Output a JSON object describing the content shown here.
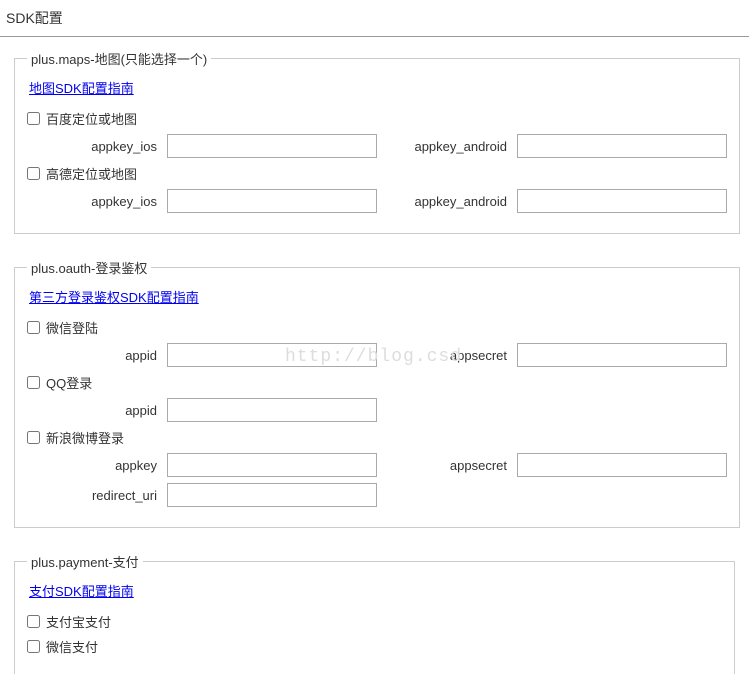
{
  "page": {
    "title": "SDK配置"
  },
  "watermark": "http://blog.csd",
  "sections": {
    "maps": {
      "legend": "plus.maps-地图(只能选择一个)",
      "guide_link": "地图SDK配置指南",
      "baidu": {
        "checkbox_label": "百度定位或地图",
        "appkey_ios_label": "appkey_ios",
        "appkey_ios_value": "",
        "appkey_android_label": "appkey_android",
        "appkey_android_value": ""
      },
      "gaode": {
        "checkbox_label": "高德定位或地图",
        "appkey_ios_label": "appkey_ios",
        "appkey_ios_value": "",
        "appkey_android_label": "appkey_android",
        "appkey_android_value": ""
      }
    },
    "oauth": {
      "legend": "plus.oauth-登录鉴权",
      "guide_link": "第三方登录鉴权SDK配置指南",
      "wechat": {
        "checkbox_label": "微信登陆",
        "appid_label": "appid",
        "appid_value": "",
        "appsecret_label": "appsecret",
        "appsecret_value": ""
      },
      "qq": {
        "checkbox_label": "QQ登录",
        "appid_label": "appid",
        "appid_value": ""
      },
      "weibo": {
        "checkbox_label": "新浪微博登录",
        "appkey_label": "appkey",
        "appkey_value": "",
        "appsecret_label": "appsecret",
        "appsecret_value": "",
        "redirect_uri_label": "redirect_uri",
        "redirect_uri_value": ""
      }
    },
    "payment": {
      "legend": "plus.payment-支付",
      "guide_link": "支付SDK配置指南",
      "alipay": {
        "checkbox_label": "支付宝支付"
      },
      "wechat": {
        "checkbox_label": "微信支付"
      }
    }
  }
}
